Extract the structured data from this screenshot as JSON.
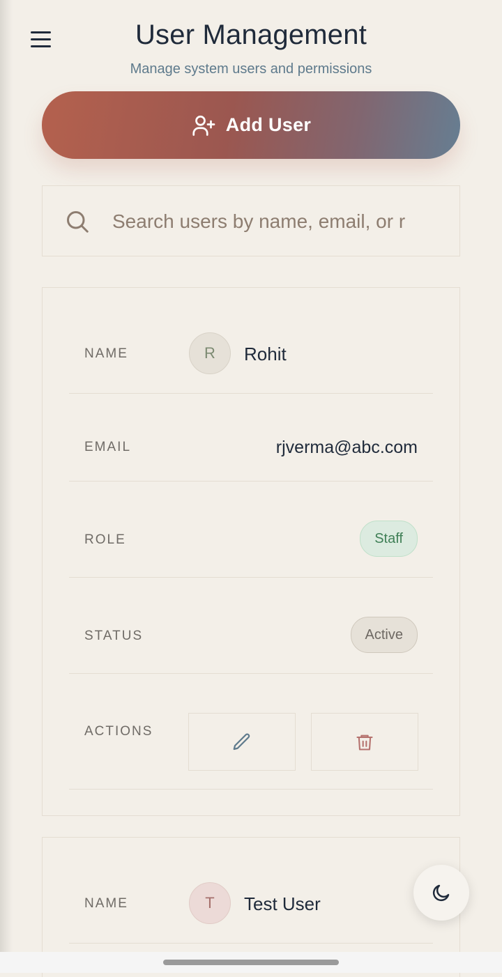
{
  "header": {
    "title": "User Management",
    "subtitle": "Manage system users and permissions",
    "menu_icon": "hamburger-menu-icon"
  },
  "add_button": {
    "label": "Add User",
    "icon": "user-plus-icon"
  },
  "search": {
    "placeholder": "Search users by name, email, or r",
    "value": "",
    "icon": "search-icon"
  },
  "labels": {
    "name": "NAME",
    "email": "EMAIL",
    "role": "ROLE",
    "status": "STATUS",
    "actions": "ACTIONS"
  },
  "users": [
    {
      "initial": "R",
      "name": "Rohit",
      "email": "rjverma@abc.com",
      "role": "Staff",
      "status": "Active",
      "avatar_bg": "#e6e1d8",
      "avatar_color": "#7c8a72"
    },
    {
      "initial": "T",
      "name": "Test User",
      "avatar_bg": "#ecdad7",
      "avatar_color": "#a5706c"
    }
  ],
  "actions": {
    "edit_icon": "pencil-icon",
    "delete_icon": "trash-icon"
  },
  "theme_toggle": {
    "icon": "moon-icon"
  },
  "colors": {
    "background": "#f3efe8",
    "gradient_start": "#b4614e",
    "gradient_end": "#667e92",
    "staff_badge": "#dcebe0",
    "edit_icon": "#5e7a8c",
    "delete_icon": "#b5726e"
  }
}
